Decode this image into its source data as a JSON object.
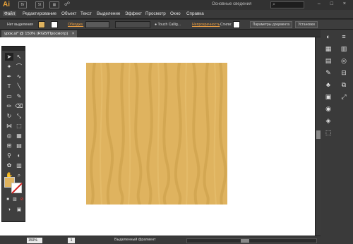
{
  "app": {
    "logo": "Ai",
    "workspace": "Основные сведения",
    "window_controls": "– □ ×",
    "tab_icon_label": "Br",
    "tb_grid": "▦",
    "tb_st": "St"
  },
  "menu": {
    "items": [
      "Файл",
      "Редактирование",
      "Объект",
      "Текст",
      "Выделение",
      "Эффект",
      "Просмотр",
      "Окно",
      "Справка"
    ]
  },
  "control": {
    "selection_label": "Нет выделения",
    "stroke_label": "Обводка:",
    "brush_label": "Touch Callig...",
    "opacity_label": "Непрозрачность",
    "styles_label": "Стили:",
    "doc_settings": "Параметры документа",
    "preferences": "Установки",
    "colors": {
      "fill": "#dfb35f",
      "accent": "#f0a040"
    }
  },
  "document": {
    "tab": "урок.ai* @ 150% (RGB/Просмотр)",
    "close": "×"
  },
  "status": {
    "zoom": "150%",
    "page": "1",
    "message": "Выделенный фрагмент"
  },
  "icons": [
    "search-icon",
    "selection-tool-icon",
    "direct-selection-icon",
    "pen-icon",
    "type-icon",
    "line-icon",
    "rectangle-icon",
    "paintbrush-icon",
    "pencil-icon",
    "eraser-icon",
    "rotate-icon",
    "scale-icon",
    "width-icon",
    "free-transform-icon",
    "shape-builder-icon",
    "mesh-icon",
    "gradient-icon",
    "eyedropper-icon",
    "blend-icon",
    "symbol-sprayer-icon",
    "graph-icon",
    "artboard-icon",
    "slice-icon",
    "hand-icon",
    "zoom-icon"
  ]
}
